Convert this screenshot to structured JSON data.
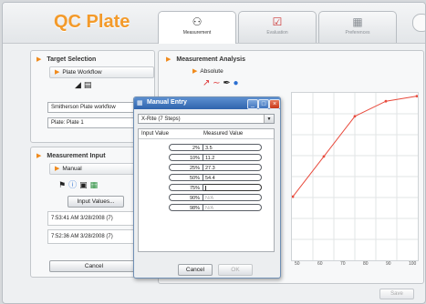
{
  "app": {
    "title": "QC Plate"
  },
  "tabs": [
    {
      "label": "Measurement",
      "icon": "measurement-icon",
      "active": true
    },
    {
      "label": "Evaluation",
      "icon": "checklist-icon",
      "active": false
    },
    {
      "label": "Preferences",
      "icon": "preferences-icon",
      "active": false
    }
  ],
  "target_selection": {
    "title": "Target Selection",
    "subtab": "Plate Workflow",
    "workflow_value": "Smitherson Plate workflow",
    "plate_value": "Plate: Plate 1"
  },
  "measurement_input": {
    "title": "Measurement Input",
    "subtab": "Manual",
    "input_values_button": "Input Values...",
    "log": [
      "7:53:41 AM 3/28/2008 (7)",
      "7:52:36 AM 3/28/2008 (7)"
    ],
    "cancel_button": "Cancel"
  },
  "measurement_analysis": {
    "title": "Measurement Analysis",
    "subtab": "Absolute"
  },
  "chart": {
    "x_ticks": [
      "50",
      "60",
      "70",
      "80",
      "90",
      "100"
    ],
    "y_values_visible": [
      0.38,
      0.62,
      0.86,
      0.95,
      0.98
    ],
    "line_color": "#e84a3c"
  },
  "manual_entry": {
    "title": "Manual Entry",
    "preset": "X-Rite (7 Steps)",
    "col_input": "Input Value",
    "col_measured": "Measured Value",
    "rows": [
      {
        "input": "2%",
        "measured": "3.5",
        "state": "filled"
      },
      {
        "input": "10%",
        "measured": "11.2",
        "state": "filled"
      },
      {
        "input": "25%",
        "measured": "27.3",
        "state": "filled"
      },
      {
        "input": "50%",
        "measured": "54.4",
        "state": "filled"
      },
      {
        "input": "75%",
        "measured": "",
        "state": "active"
      },
      {
        "input": "90%",
        "measured": "N/A",
        "state": "na"
      },
      {
        "input": "98%",
        "measured": "N/A",
        "state": "na"
      }
    ],
    "cancel_button": "Cancel",
    "ok_button": "OK"
  },
  "footer": {
    "save_button": "Save"
  }
}
